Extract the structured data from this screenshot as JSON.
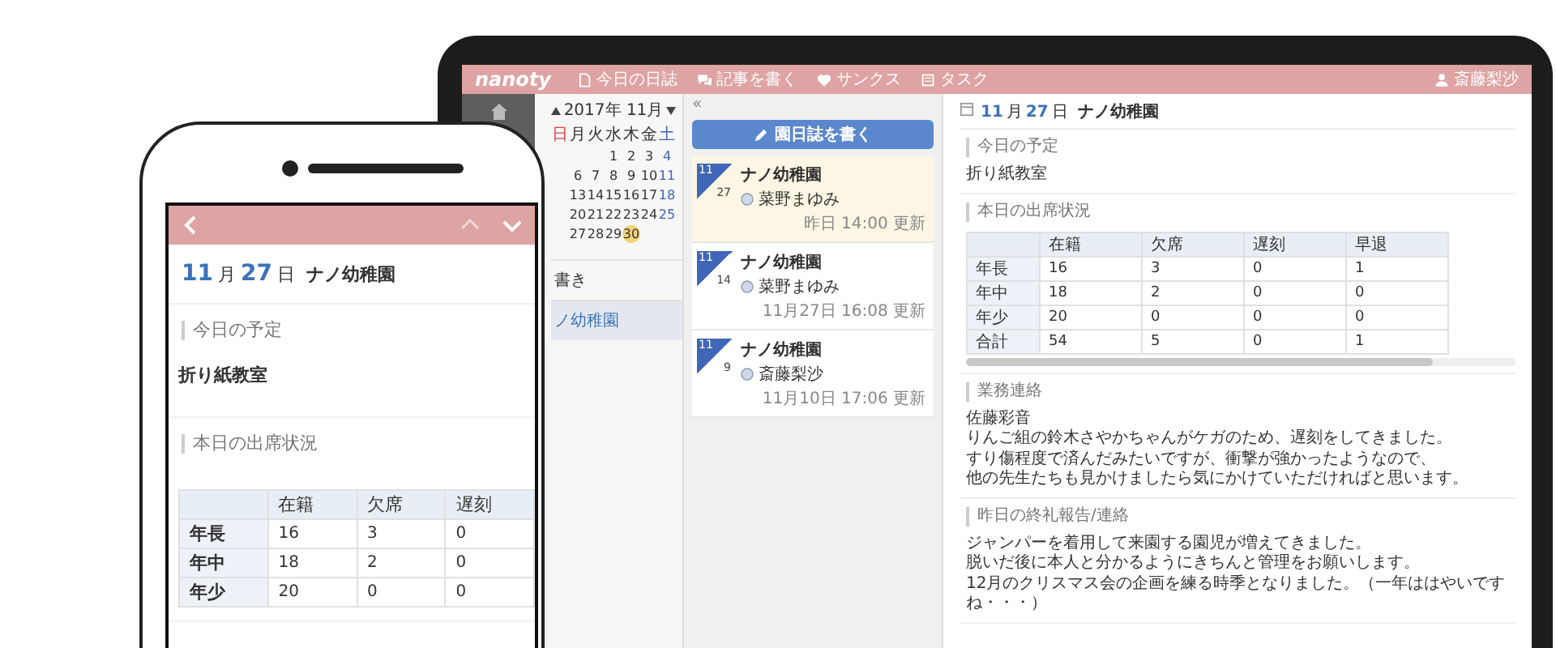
{
  "tablet": {
    "header": {
      "logo": "nanoty",
      "nav": [
        "今日の日誌",
        "記事を書く",
        "サンクス",
        "タスク"
      ],
      "user": "斎藤梨沙"
    },
    "calendar": {
      "title": "2017年 11月",
      "weekdays": [
        "日",
        "月",
        "火",
        "水",
        "木",
        "金",
        "土"
      ],
      "weeks": [
        [
          {
            "day": "1",
            "selected": false
          },
          {
            "day": "2",
            "selected": false
          },
          {
            "day": "3",
            "selected": false
          },
          {
            "day": "4",
            "selected": false
          }
        ],
        [
          {
            "day": "6",
            "selected": false
          },
          {
            "day": "7",
            "selected": false
          },
          {
            "day": "8",
            "selected": false
          },
          {
            "day": "9",
            "selected": false
          },
          {
            "day": "10",
            "selected": false
          },
          {
            "day": "11",
            "selected": false
          }
        ],
        [
          {
            "day": "13",
            "selected": false
          },
          {
            "day": "14",
            "selected": false
          },
          {
            "day": "15",
            "selected": false
          },
          {
            "day": "16",
            "selected": false
          },
          {
            "day": "17",
            "selected": false
          },
          {
            "day": "18",
            "selected": false
          }
        ],
        [
          {
            "day": "20",
            "selected": false
          },
          {
            "day": "21",
            "selected": false
          },
          {
            "day": "22",
            "selected": false
          },
          {
            "day": "23",
            "selected": false
          },
          {
            "day": "24",
            "selected": false
          },
          {
            "day": "25",
            "selected": false
          }
        ],
        [
          {
            "day": "27",
            "selected": false
          },
          {
            "day": "28",
            "selected": false
          },
          {
            "day": "29",
            "selected": false
          },
          {
            "day": "30",
            "selected": true
          }
        ]
      ]
    },
    "side_items": [
      {
        "label": "書き",
        "selected": false
      },
      {
        "label": "ノ幼稚園",
        "selected": true
      }
    ],
    "collapse": "«",
    "write_button": "園日誌を書く",
    "entries": [
      {
        "month": "11",
        "day": "27",
        "title": "ナノ幼稚園",
        "author": "菜野まゆみ",
        "updated": "昨日 14:00 更新",
        "selected": true
      },
      {
        "month": "11",
        "day": "14",
        "title": "ナノ幼稚園",
        "author": "菜野まゆみ",
        "updated": "11月27日 16:08 更新",
        "selected": false
      },
      {
        "month": "11",
        "day": "9",
        "title": "ナノ幼稚園",
        "author": "斎藤梨沙",
        "updated": "11月10日 17:06 更新",
        "selected": false
      }
    ],
    "detail": {
      "date": {
        "month": "11",
        "month_unit": "月",
        "day": "27",
        "day_unit": "日",
        "place": "ナノ幼稚園"
      },
      "sections": [
        {
          "kind": "text",
          "heading": "今日の予定",
          "lines": [
            "折り紙教室"
          ]
        },
        {
          "kind": "table",
          "heading": "本日の出席状況",
          "columns": [
            "在籍",
            "欠席",
            "遅刻",
            "早退"
          ],
          "rows": [
            {
              "label": "年長",
              "cells": [
                "16",
                "3",
                "0",
                "1"
              ]
            },
            {
              "label": "年中",
              "cells": [
                "18",
                "2",
                "0",
                "0"
              ]
            },
            {
              "label": "年少",
              "cells": [
                "20",
                "0",
                "0",
                "0"
              ]
            },
            {
              "label": "合計",
              "cells": [
                "54",
                "5",
                "0",
                "1"
              ]
            }
          ]
        },
        {
          "kind": "text",
          "heading": "業務連絡",
          "lines": [
            "佐藤彩音",
            "りんご組の鈴木さやかちゃんがケガのため、遅刻をしてきました。",
            "すり傷程度で済んだみたいですが、衝撃が強かったようなので、",
            "他の先生たちも見かけましたら気にかけていただければと思います。"
          ]
        },
        {
          "kind": "text",
          "heading": "昨日の終礼報告/連絡",
          "lines": [
            "ジャンパーを着用して来園する園児が増えてきました。",
            "脱いだ後に本人と分かるようにきちんと管理をお願いします。",
            "12月のクリスマス会の企画を練る時季となりました。（一年ははやいですね・・・）"
          ]
        }
      ]
    }
  },
  "phone": {
    "date": {
      "month": "11",
      "month_unit": "月",
      "day": "27",
      "day_unit": "日",
      "place": "ナノ幼稚園"
    },
    "sections": [
      {
        "kind": "text",
        "heading": "今日の予定",
        "lines": [
          "折り紙教室"
        ]
      },
      {
        "kind": "table",
        "heading": "本日の出席状況",
        "columns": [
          "在籍",
          "欠席",
          "遅刻"
        ],
        "rows": [
          {
            "label": "年長",
            "cells": [
              "16",
              "3",
              "0"
            ]
          },
          {
            "label": "年中",
            "cells": [
              "18",
              "2",
              "0"
            ]
          },
          {
            "label": "年少",
            "cells": [
              "20",
              "0",
              "0"
            ]
          }
        ]
      }
    ]
  }
}
